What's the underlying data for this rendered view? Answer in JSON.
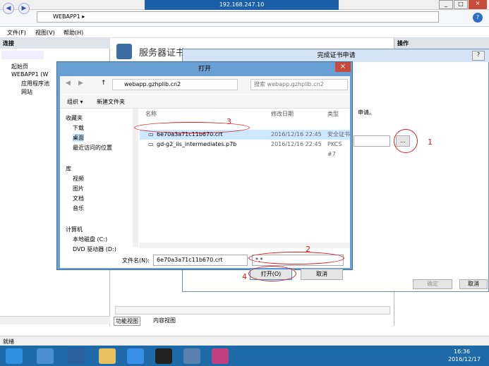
{
  "window": {
    "rd_address": "192.168.247.10",
    "address_segment": "WEBAPP1",
    "menus": [
      "文件(F)",
      "视图(V)",
      "帮助(H)"
    ]
  },
  "left_pane": {
    "header": "连接",
    "tree": [
      "起始页",
      "WEBAPP1 (W",
      "应用程序池",
      "网站"
    ]
  },
  "center": {
    "title": "服务器证书",
    "tabs": [
      "功能视图",
      "内容视图"
    ]
  },
  "right_pane": {
    "header": "操作"
  },
  "status": {
    "text": "就绪"
  },
  "cert_dialog": {
    "title": "完成证书申请",
    "help": "?",
    "hint": "申请。",
    "browse_label": "...",
    "ok_label": "确定",
    "cancel_label": "取消"
  },
  "open_dialog": {
    "title": "打开",
    "close": "×",
    "path": "webapp.gzhplib.cn2",
    "search_placeholder": "搜索 webapp.gzhplib.cn2",
    "organize": "组织 ▾",
    "new_folder": "新建文件夹",
    "sidebar": [
      "收藏夹",
      "下载",
      "桌面",
      "最近访问的位置",
      "库",
      "视频",
      "图片",
      "文档",
      "音乐",
      "计算机",
      "本地磁盘 (C:)",
      "DVD 驱动器 (D:)"
    ],
    "columns": [
      "名称",
      "修改日期",
      "类型"
    ],
    "files": [
      {
        "name": "6e70a3a71c11b670.crt",
        "date": "2016/12/16 22:45",
        "type": "安全证书"
      },
      {
        "name": "gd-g2_iis_intermediates.p7b",
        "date": "2016/12/16 22:45",
        "type": "PKCS #7"
      }
    ],
    "filename_label": "文件名(N):",
    "filename_value": "6e70a3a71c11b670.crt",
    "filter_value": "*.*",
    "open_label": "打开(O)",
    "cancel_label": "取消"
  },
  "annotations": [
    "1",
    "2",
    "3",
    "4"
  ],
  "clock": {
    "time": "16:36",
    "date": "2016/12/17"
  }
}
